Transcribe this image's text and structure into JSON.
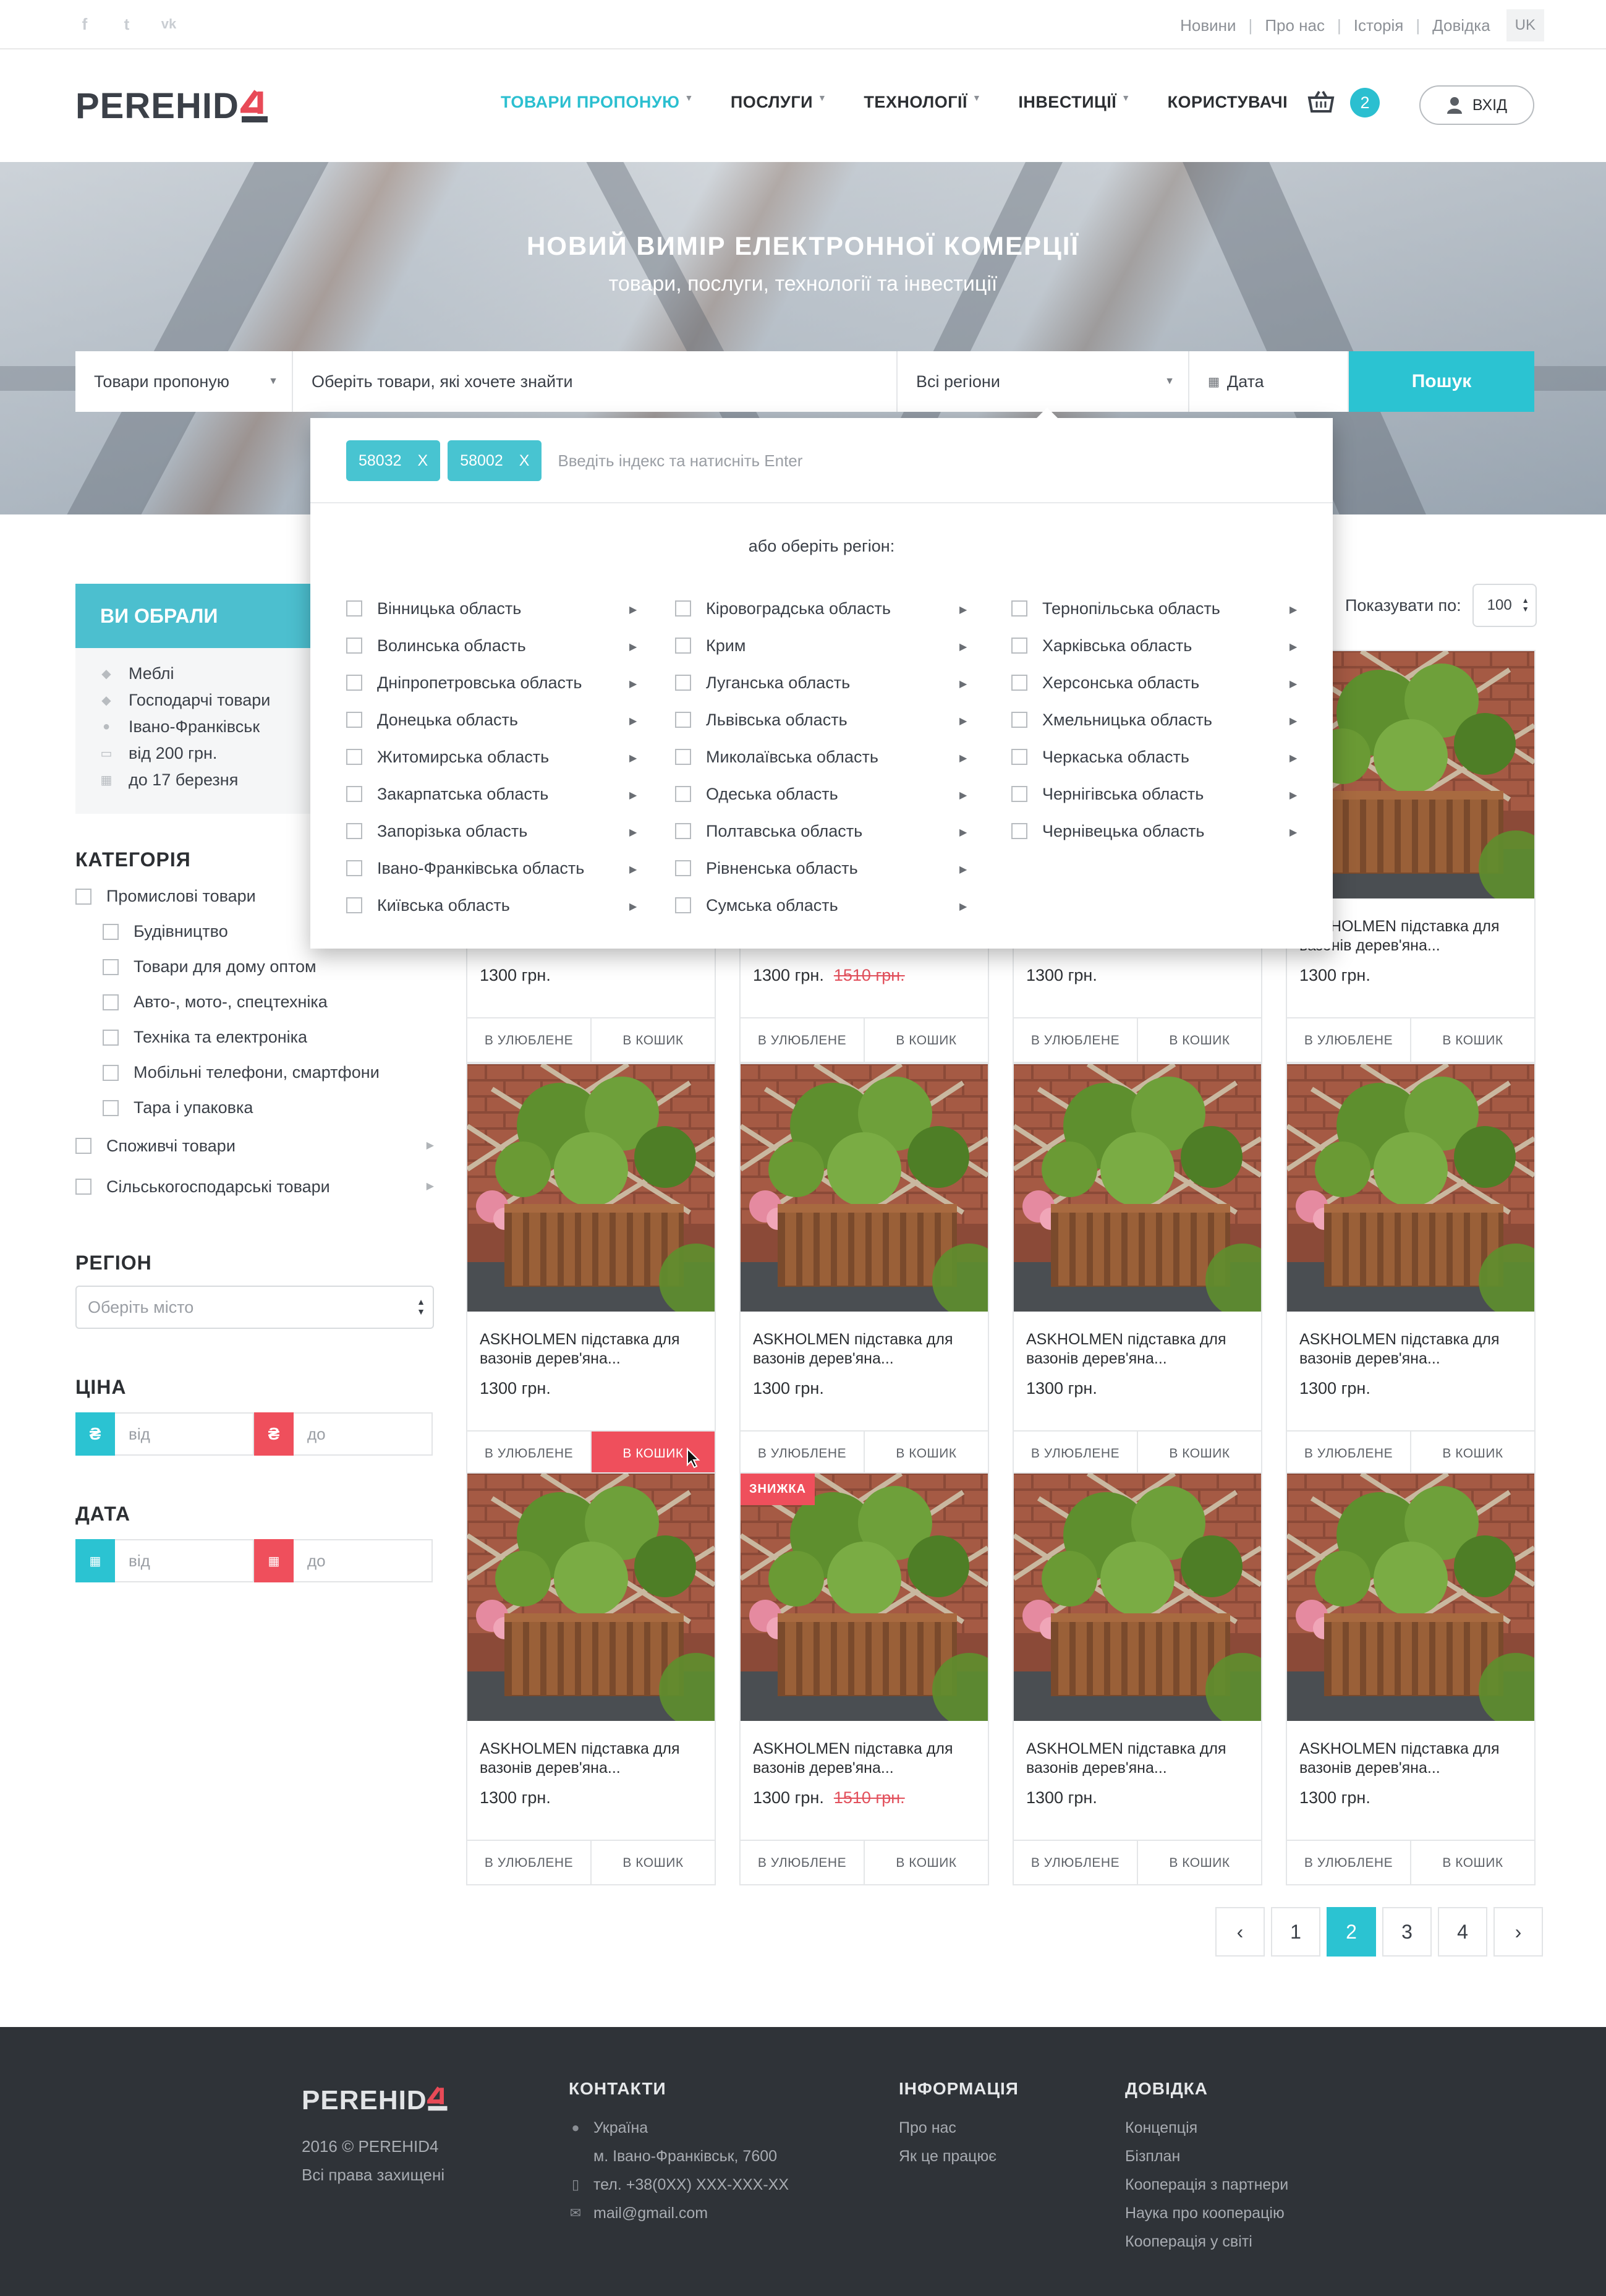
{
  "topbar": {
    "social": [
      {
        "icon": "facebook-icon",
        "glyph": "f"
      },
      {
        "icon": "twitter-icon",
        "glyph": "t"
      },
      {
        "icon": "vk-icon",
        "glyph": "vk"
      }
    ],
    "links": [
      "Новини",
      "Про нас",
      "Історія",
      "Довідка"
    ],
    "lang": "UK"
  },
  "header": {
    "logo": "PEREHID",
    "nav": [
      {
        "label": "ТОВАРИ ПРОПОНУЮ",
        "active": true,
        "caret": true
      },
      {
        "label": "ПОСЛУГИ",
        "active": false,
        "caret": true
      },
      {
        "label": "ТЕХНОЛОГІЇ",
        "active": false,
        "caret": true
      },
      {
        "label": "ІНВЕСТИЦІЇ",
        "active": false,
        "caret": true
      },
      {
        "label": "КОРИСТУВАЧІ",
        "active": false,
        "caret": false
      }
    ],
    "cart_count": "2",
    "login": "ВХІД"
  },
  "hero": {
    "title": "НОВИЙ ВИМІР ЕЛЕКТРОННОЇ КОМЕРЦІЇ",
    "subtitle": "товари, послуги, технології та інвестиції"
  },
  "search": {
    "type": "Товари пропоную",
    "query_placeholder": "Оберіть товари, які хочете знайти",
    "region": "Всі регіони",
    "date": "Дата",
    "button": "Пошук"
  },
  "region_dropdown": {
    "tags": [
      "58032",
      "58002"
    ],
    "tag_remove": "X",
    "index_placeholder": "Введіть індекс та натисніть Enter",
    "or_choose": "або оберіть регіон:",
    "columns": [
      [
        "Вінницька область",
        "Волинська область",
        "Дніпропетровська область",
        "Донецька область",
        "Житомирська область",
        "Закарпатська область",
        "Запорізька область",
        "Івано-Франківська область",
        "Київська область"
      ],
      [
        "Кіровоградська область",
        "Крим",
        "Луганська область",
        "Львівська область",
        "Миколаївська область",
        "Одеська область",
        "Полтавська область",
        "Рівненська область",
        "Сумська область"
      ],
      [
        "Тернопільська область",
        "Харківська область",
        "Херсонська область",
        "Хмельницька область",
        "Черкаська область",
        "Чернігівська область",
        "Чернівецька область"
      ]
    ]
  },
  "sidebar": {
    "chosen_title": "ВИ ОБРАЛИ",
    "chosen": [
      {
        "icon": "tag-icon",
        "label": "Меблі"
      },
      {
        "icon": "tag-icon",
        "label": "Господарчі товари"
      },
      {
        "icon": "map-pin-icon",
        "label": "Івано-Франківськ"
      },
      {
        "icon": "money-icon",
        "label": "від 200 грн."
      },
      {
        "icon": "calendar-icon",
        "label": "до 17 березня"
      }
    ],
    "category_title": "КАТЕГОРІЯ",
    "categories": [
      {
        "label": "Промислові товари",
        "indent": false,
        "arrow": false
      },
      {
        "label": "Будівництво",
        "indent": true,
        "arrow": false
      },
      {
        "label": "Товари для дому оптом",
        "indent": true,
        "arrow": false
      },
      {
        "label": "Авто-, мото-, спецтехніка",
        "indent": true,
        "arrow": false
      },
      {
        "label": "Техніка та електроніка",
        "indent": true,
        "arrow": false
      },
      {
        "label": "Мобільні телефони, смартфони",
        "indent": true,
        "arrow": false
      },
      {
        "label": "Тара і упаковка",
        "indent": true,
        "arrow": false
      },
      {
        "label": "Споживчі товари",
        "indent": false,
        "arrow": true
      },
      {
        "label": "Сільськогосподарські товари",
        "indent": false,
        "arrow": true
      }
    ],
    "region_title": "РЕГІОН",
    "region_placeholder": "Оберіть місто",
    "price_title": "ЦІНА",
    "price_from": "від",
    "price_to": "до",
    "currency_glyph": "₴",
    "date_title": "ДАТА",
    "date_from": "від",
    "date_to": "до"
  },
  "listing": {
    "show_by_label": "Показувати по:",
    "show_by_value": "100",
    "fav_label": "В УЛЮБЛЕНЕ",
    "cart_label": "В КОШИК",
    "sale_label": "ЗНИЖКА",
    "product_title": "ASKHOLMEN підставка для вазонів дерев'яна...",
    "product_title_first_row": "ASKHOLMEN підставка для вазонів дерев'яна...",
    "products": [
      {
        "row": 0,
        "col": 0,
        "title": "",
        "price": "1300 грн.",
        "old": ""
      },
      {
        "row": 0,
        "col": 1,
        "title": "",
        "price": "1300 грн.",
        "old": "1510 грн."
      },
      {
        "row": 0,
        "col": 2,
        "title": "",
        "price": "1300 грн.",
        "old": ""
      },
      {
        "row": 0,
        "col": 3,
        "title": "ASKHOLMEN підставка для вазонів дерев'яна...",
        "price": "1300 грн.",
        "old": ""
      },
      {
        "row": 1,
        "col": 0,
        "title": "ASKHOLMEN підставка для вазонів дерев'яна...",
        "price": "1300 грн.",
        "old": "",
        "cart_active": true
      },
      {
        "row": 1,
        "col": 1,
        "title": "ASKHOLMEN підставка для вазонів дерев'яна...",
        "price": "1300 грн.",
        "old": ""
      },
      {
        "row": 1,
        "col": 2,
        "title": "ASKHOLMEN підставка для вазонів дерев'яна...",
        "price": "1300 грн.",
        "old": ""
      },
      {
        "row": 1,
        "col": 3,
        "title": "ASKHOLMEN підставка для вазонів дерев'яна...",
        "price": "1300 грн.",
        "old": ""
      },
      {
        "row": 2,
        "col": 0,
        "title": "ASKHOLMEN підставка для вазонів дерев'яна...",
        "price": "1300 грн.",
        "old": ""
      },
      {
        "row": 2,
        "col": 1,
        "title": "ASKHOLMEN підставка для вазонів дерев'яна...",
        "price": "1300 грн.",
        "old": "1510 грн.",
        "sale": true
      },
      {
        "row": 2,
        "col": 2,
        "title": "ASKHOLMEN підставка для вазонів дерев'яна...",
        "price": "1300 грн.",
        "old": ""
      },
      {
        "row": 2,
        "col": 3,
        "title": "ASKHOLMEN підставка для вазонів дерев'яна...",
        "price": "1300 грн.",
        "old": ""
      }
    ],
    "pagination": {
      "prev": "‹",
      "pages": [
        "1",
        "2",
        "3",
        "4"
      ],
      "current": "2",
      "next": "›"
    }
  },
  "footer": {
    "logo": "PEREHID",
    "copyright": "2016 © PEREHID4",
    "rights": "Всі права захищені",
    "contacts_title": "КОНТАКТИ",
    "contacts": [
      {
        "icon": "map-pin-icon",
        "label": "Україна"
      },
      {
        "icon": "",
        "label": "м. Івано-Франківськ, 7600"
      },
      {
        "icon": "phone-icon",
        "label": "тел. +38(0XX) XXX-XXX-XX"
      },
      {
        "icon": "mail-icon",
        "label": "mail@gmail.com"
      }
    ],
    "info_title": "ІНФОРМАЦІЯ",
    "info": [
      "Про нас",
      "Як це працює"
    ],
    "help_title": "ДОВІДКА",
    "help": [
      "Концепція",
      "Бізплан",
      "Кооперація з партнери",
      "Наука про кооперацію",
      "Кооперація у світі"
    ]
  },
  "colors": {
    "accent": "#2bc3d2",
    "danger": "#ef4f5c",
    "dark": "#2f3338",
    "text": "#2c2f33"
  }
}
